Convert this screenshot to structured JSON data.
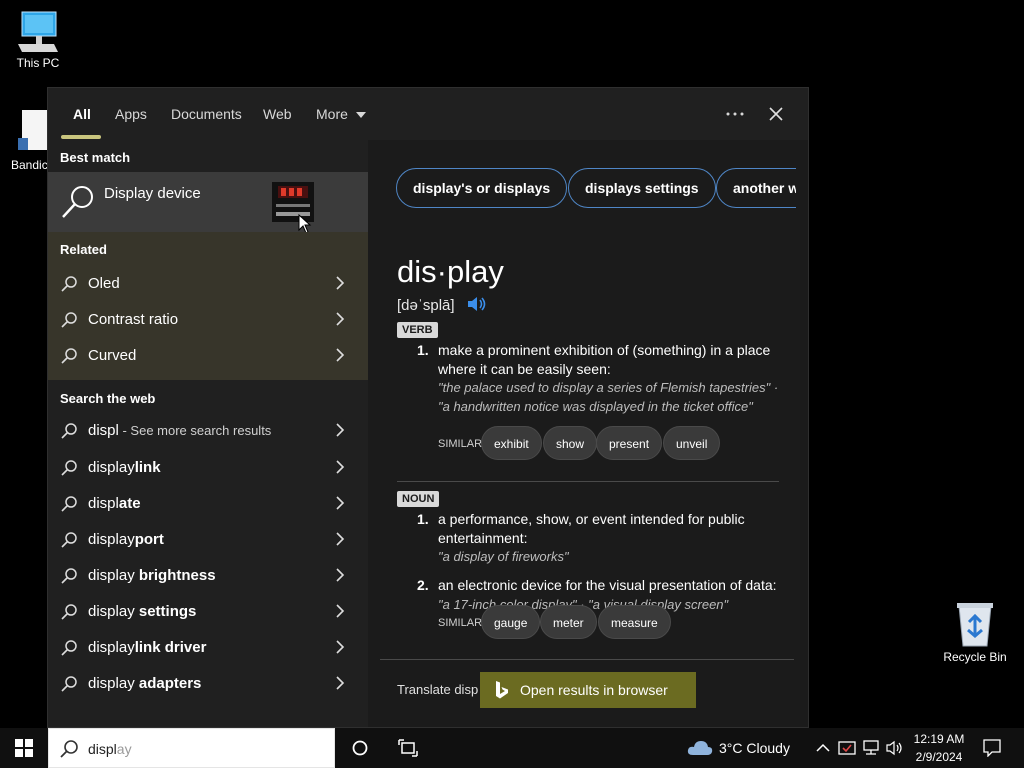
{
  "desktop": {
    "icons": [
      {
        "label": "This PC"
      },
      {
        "label": "Bandic"
      },
      {
        "label": "Recycle Bin"
      }
    ]
  },
  "tabs": [
    "All",
    "Apps",
    "Documents",
    "Web",
    "More"
  ],
  "left": {
    "best_match_header": "Best match",
    "best_match_title": "Display device",
    "related_header": "Related",
    "related": [
      "Oled",
      "Contrast ratio",
      "Curved"
    ],
    "web_header": "Search the web",
    "web_first_query": "displ",
    "web_first_sub": " - See more search results",
    "web_suggestions": [
      {
        "prefix": "display",
        "suffix": "link"
      },
      {
        "prefix": "displ",
        "suffix": "ate"
      },
      {
        "prefix": "display",
        "suffix": "port"
      },
      {
        "prefix": "display",
        "suffix": " brightness"
      },
      {
        "prefix": "display",
        "suffix": " settings"
      },
      {
        "prefix": "display",
        "suffix": "link driver"
      },
      {
        "prefix": "display",
        "suffix": " adapters"
      }
    ]
  },
  "right": {
    "chips": [
      "display's or displays",
      "displays settings",
      "another w"
    ],
    "word": "dis·play",
    "pronunciation": "[dəˈsplā]",
    "verb_badge": "VERB",
    "verb_def": "make a prominent exhibition of (something) in a place where it can be easily seen:",
    "verb_example": "\"the palace used to display a series of Flemish tapestries\" · \"a handwritten notice was displayed in the ticket office\"",
    "similar_label": "SIMILAR:",
    "verb_similar": [
      "exhibit",
      "show",
      "present",
      "unveil"
    ],
    "noun_badge": "NOUN",
    "noun_def1": "a performance, show, or event intended for public entertainment:",
    "noun_example1": "\"a display of fireworks\"",
    "noun_def2": "an electronic device for the visual presentation of data:",
    "noun_example2": "\"a 17-inch color display\" · \"a visual display screen\"",
    "noun_similar": [
      "gauge",
      "meter",
      "measure"
    ],
    "num1": "1.",
    "num2": "2.",
    "translate": "Translate disp",
    "open_browser": "Open results in browser"
  },
  "taskbar": {
    "search_typed": "displ",
    "search_autocomplete": "ay",
    "weather": "3°C  Cloudy",
    "time": "12:19 AM",
    "date": "2/9/2024"
  },
  "colors": {
    "accent_underline": "#c9c57e",
    "chip_border": "#4f86c6",
    "related_bg": "#37352a",
    "open_browser_bg": "#6b6b21"
  }
}
